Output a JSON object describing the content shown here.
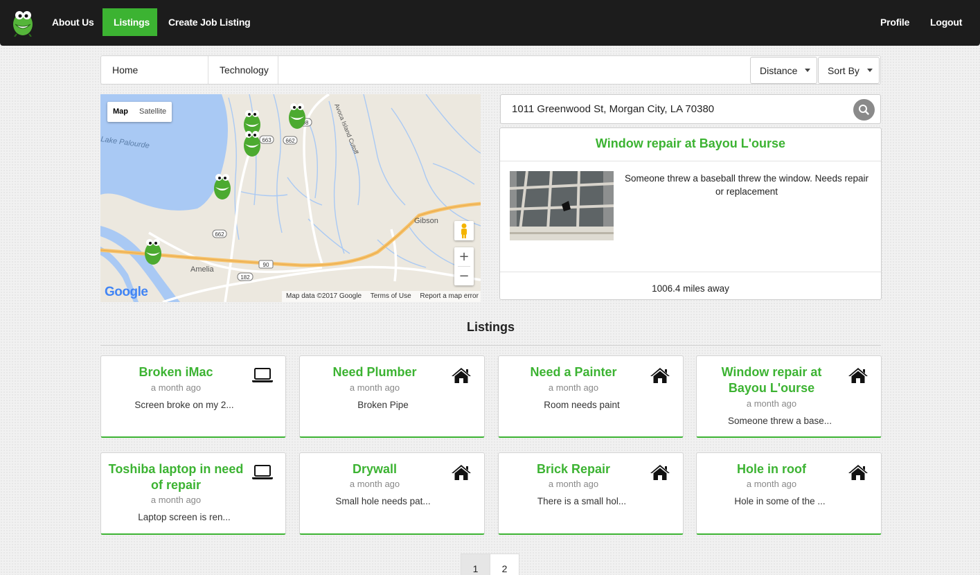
{
  "nav": {
    "logo_name": "gator-logo",
    "links": [
      {
        "label": "About Us",
        "active": false
      },
      {
        "label": "Listings",
        "active": true
      },
      {
        "label": "Create Job Listing",
        "active": false
      }
    ],
    "right_links": [
      {
        "label": "Profile"
      },
      {
        "label": "Logout"
      }
    ],
    "accent_color": "#3cb332",
    "background_color": "#1c1c1c"
  },
  "categories": {
    "tabs": [
      "Home Improvement",
      "Technology"
    ],
    "distance_label": "Distance",
    "sort_label": "Sort By"
  },
  "map": {
    "type_buttons": [
      "Map",
      "Satellite"
    ],
    "selected_type": "Map",
    "places": [
      "Lake Palourde",
      "Gibson",
      "Amelia",
      "Avoca Island Cutoff"
    ],
    "route_shields": [
      "663",
      "662",
      "98",
      "662",
      "90",
      "182"
    ],
    "zoom_in": "+",
    "zoom_out": "−",
    "google_logo": "Google",
    "footer": [
      "Map data ©2017 Google",
      "Terms of Use",
      "Report a map error"
    ]
  },
  "search": {
    "value": "1011 Greenwood St, Morgan City, LA 70380",
    "icon": "search-icon"
  },
  "detail": {
    "title": "Window repair at Bayou L'ourse",
    "description": "Someone threw a baseball threw the window. Needs repair or replacement",
    "distance": "1006.4 miles away"
  },
  "listings": {
    "heading": "Listings",
    "items": [
      {
        "title": "Broken iMac",
        "time": "a month ago",
        "desc": "Screen broke on my 2...",
        "icon": "laptop-icon"
      },
      {
        "title": "Need Plumber",
        "time": "a month ago",
        "desc": "Broken Pipe",
        "icon": "home-icon"
      },
      {
        "title": "Need a Painter",
        "time": "a month ago",
        "desc": "Room needs paint",
        "icon": "home-icon"
      },
      {
        "title": "Window repair at Bayou L'ourse",
        "time": "a month ago",
        "desc": "Someone threw a base...",
        "icon": "home-icon"
      },
      {
        "title": "Toshiba laptop in need of repair",
        "time": "a month ago",
        "desc": "Laptop screen is ren...",
        "icon": "laptop-icon"
      },
      {
        "title": "Drywall",
        "time": "a month ago",
        "desc": "Small hole needs pat...",
        "icon": "home-icon"
      },
      {
        "title": "Brick Repair",
        "time": "a month ago",
        "desc": "There is a small hol...",
        "icon": "home-icon"
      },
      {
        "title": "Hole in roof",
        "time": "a month ago",
        "desc": "Hole in some of the ...",
        "icon": "home-icon"
      }
    ]
  },
  "pagination": {
    "pages": [
      "1",
      "2"
    ],
    "current": "1"
  }
}
